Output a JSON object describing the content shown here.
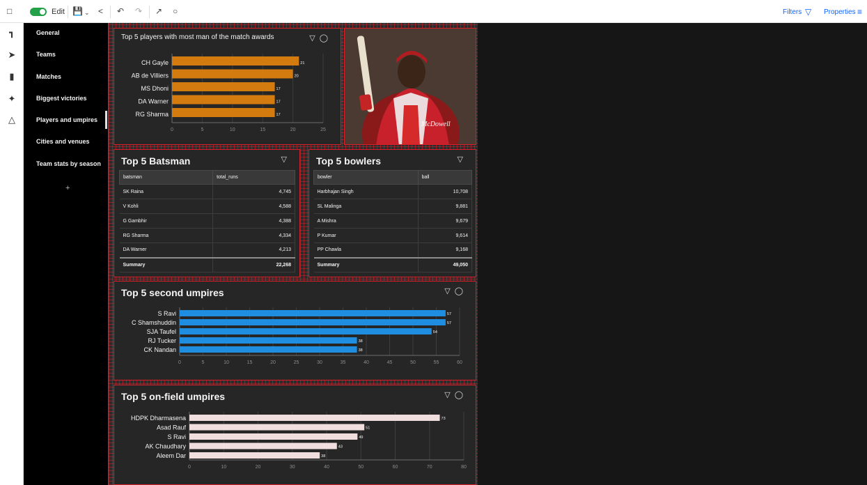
{
  "toolbar": {
    "edit_label": "Edit",
    "filters_label": "Filters",
    "properties_label": "Properties"
  },
  "nav": {
    "items": [
      {
        "label": "General"
      },
      {
        "label": "Teams"
      },
      {
        "label": "Matches"
      },
      {
        "label": "Biggest victories"
      },
      {
        "label": "Players and umpires"
      },
      {
        "label": "Cities and venues"
      },
      {
        "label": "Team stats by season"
      }
    ],
    "active": "Players and umpires",
    "add_label": "+"
  },
  "mom": {
    "title": "Top 5 players with most man of the match awards",
    "chart_data": {
      "type": "bar",
      "orientation": "horizontal",
      "categories": [
        "CH Gayle",
        "AB de Villiers",
        "MS Dhoni",
        "DA Warner",
        "RG Sharma"
      ],
      "values": [
        21,
        20,
        17,
        17,
        17
      ],
      "xticks": [
        "0",
        "5",
        "10",
        "15",
        "20",
        "25"
      ],
      "xlim": [
        0,
        25
      ],
      "color": "#d47b0f"
    }
  },
  "batsman": {
    "title": "Top 5 Batsman",
    "columns": [
      "batsman",
      "total_runs"
    ],
    "rows": [
      [
        "SK Raina",
        "4,745"
      ],
      [
        "V Kohli",
        "4,588"
      ],
      [
        "G Gambhir",
        "4,388"
      ],
      [
        "RG Sharma",
        "4,334"
      ],
      [
        "DA Warner",
        "4,213"
      ]
    ],
    "summary": [
      "Summary",
      "22,268"
    ]
  },
  "bowlers": {
    "title": "Top 5 bowlers",
    "columns": [
      "bowler",
      "ball"
    ],
    "rows": [
      [
        "Harbhajan Singh",
        "10,708"
      ],
      [
        "SL Malinga",
        "9,881"
      ],
      [
        "A Mishra",
        "9,679"
      ],
      [
        "P Kumar",
        "9,614"
      ],
      [
        "PP Chawla",
        "9,168"
      ]
    ],
    "summary": [
      "Summary",
      "49,050"
    ]
  },
  "second_umpires": {
    "title": "Top 5 second umpires",
    "chart_data": {
      "type": "bar",
      "orientation": "horizontal",
      "categories": [
        "S Ravi",
        "C Shamshuddin",
        "SJA Taufel",
        "RJ Tucker",
        "CK Nandan"
      ],
      "values": [
        57,
        57,
        54,
        38,
        38
      ],
      "xticks": [
        "0",
        "5",
        "10",
        "15",
        "20",
        "25",
        "30",
        "35",
        "40",
        "45",
        "50",
        "55",
        "60"
      ],
      "xlim": [
        0,
        60
      ],
      "color": "#1f8ee0"
    }
  },
  "onfield_umpires": {
    "title": "Top 5 on-field umpires",
    "chart_data": {
      "type": "bar",
      "orientation": "horizontal",
      "categories": [
        "HDPK Dharmasena",
        "Asad Rauf",
        "S Ravi",
        "AK Chaudhary",
        "Aleem Dar"
      ],
      "values": [
        73,
        51,
        49,
        43,
        38
      ],
      "xticks": [
        "0",
        "10",
        "20",
        "30",
        "40",
        "50",
        "60",
        "70",
        "80"
      ],
      "xlim": [
        0,
        80
      ],
      "color": "#f0dede"
    }
  },
  "colors": {
    "accent_blue": "#0f62fe",
    "edit_toggle": "#24a148",
    "panel_border": "#da1e28"
  }
}
